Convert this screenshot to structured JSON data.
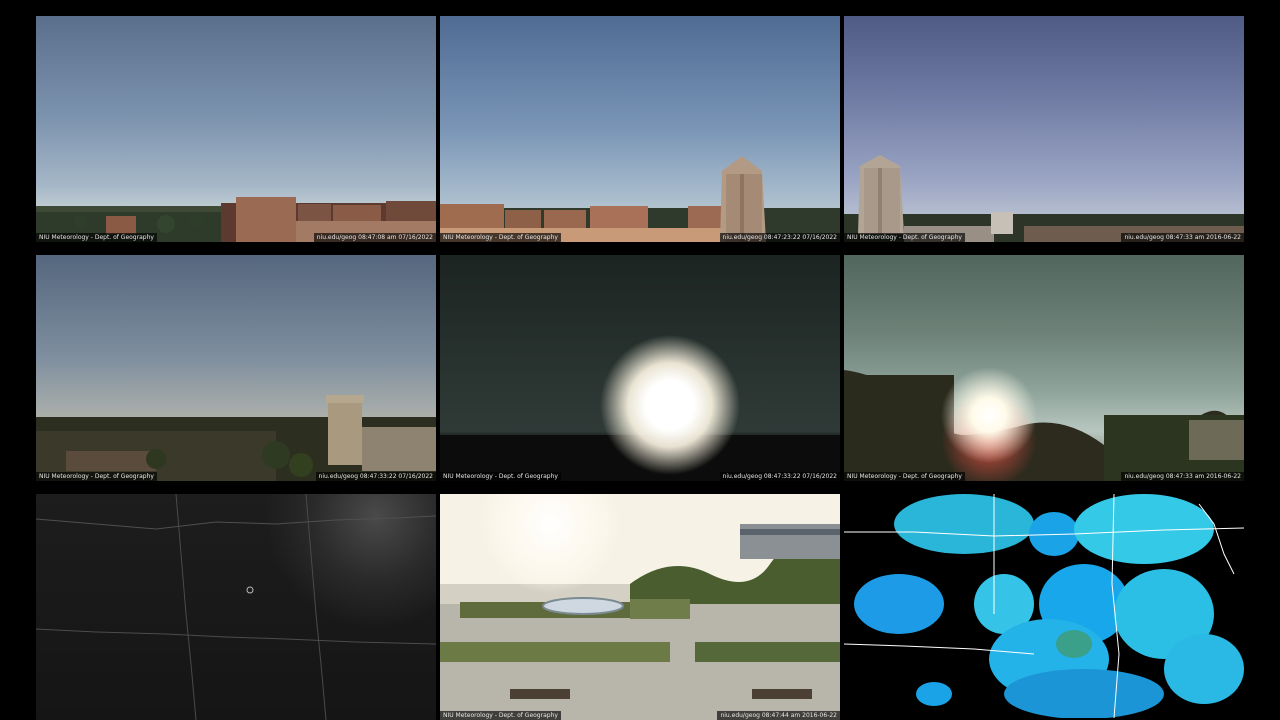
{
  "tiles": [
    {
      "caption_left": "NIU Meteorology - Dept. of Geography",
      "caption_right": "niu.edu/geog  08:47:08 am 07/16/2022"
    },
    {
      "caption_left": "NIU Meteorology - Dept. of Geography",
      "caption_right": "niu.edu/geog  08:47:23:22 07/16/2022"
    },
    {
      "caption_left": "NIU Meteorology - Dept. of Geography",
      "caption_right": "niu.edu/geog  08:47:33 am 2016-06-22"
    },
    {
      "caption_left": "NIU Meteorology - Dept. of Geography",
      "caption_right": "niu.edu/geog  08:47:33:22 07/16/2022"
    },
    {
      "caption_left": "NIU Meteorology - Dept. of Geography",
      "caption_right": "niu.edu/geog  08:47:33:22 07/16/2022"
    },
    {
      "caption_left": "NIU Meteorology - Dept. of Geography",
      "caption_right": "niu.edu/geog  08:47:33 am 2016-06-22"
    },
    {
      "caption_left": "",
      "caption_right": ""
    },
    {
      "caption_left": "NIU Meteorology - Dept. of Geography",
      "caption_right": "niu.edu/geog  08:47:44 am 2016-06-22"
    },
    {
      "caption_left": "",
      "caption_right": ""
    }
  ],
  "icons": {
    "sun": "sun-icon",
    "radar": "radar-map-icon",
    "satellite": "satellite-map-icon"
  }
}
